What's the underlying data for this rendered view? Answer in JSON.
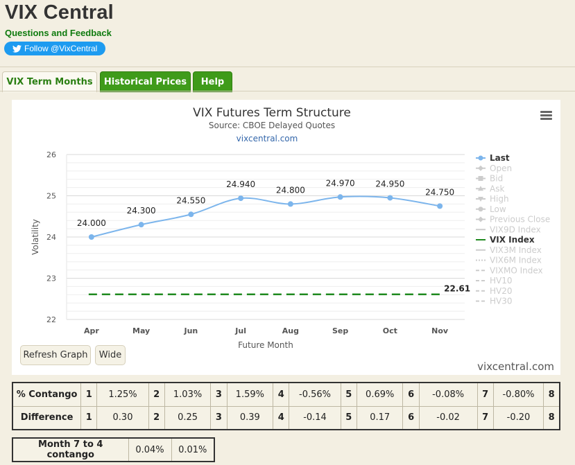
{
  "header": {
    "title": "VIX Central",
    "feedback_link": "Questions and Feedback",
    "follow_button": "Follow @VixCentral"
  },
  "tabs": [
    {
      "label": "VIX Term Months",
      "active": true
    },
    {
      "label": "Historical Prices",
      "active": false
    },
    {
      "label": "Help",
      "active": false
    }
  ],
  "chart": {
    "menu_icon": "hamburger-menu-icon",
    "buttons": {
      "refresh": "Refresh Graph",
      "wide": "Wide"
    },
    "watermark": "vixcentral.com",
    "accent_colors": {
      "last": "#7cb5ec",
      "vix": "#1f8a1f"
    }
  },
  "chart_data": {
    "type": "line",
    "title": "VIX Futures Term Structure",
    "subtitle": "Source: CBOE Delayed Quotes",
    "credit": "vixcentral.com",
    "xlabel": "Future Month",
    "ylabel": "Volatility",
    "categories": [
      "Apr",
      "May",
      "Jun",
      "Jul",
      "Aug",
      "Sep",
      "Oct",
      "Nov"
    ],
    "ylim": [
      22,
      26
    ],
    "yticks": [
      "22",
      "23",
      "24",
      "25",
      "26"
    ],
    "series": [
      {
        "name": "Last",
        "values": [
          24.0,
          24.3,
          24.55,
          24.94,
          24.8,
          24.97,
          24.95,
          24.75
        ],
        "labels": [
          "24.000",
          "24.300",
          "24.550",
          "24.940",
          "24.800",
          "24.970",
          "24.950",
          "24.750"
        ]
      },
      {
        "name": "VIX Index",
        "values": [
          22.61,
          22.61,
          22.61,
          22.61,
          22.61,
          22.61,
          22.61,
          22.61
        ],
        "end_label": "22.61"
      }
    ],
    "legend": {
      "placement": "right",
      "items": [
        {
          "label": "Last",
          "enabled": true,
          "symbol": "circle"
        },
        {
          "label": "Open",
          "enabled": false,
          "symbol": "diamond"
        },
        {
          "label": "Bid",
          "enabled": false,
          "symbol": "square"
        },
        {
          "label": "Ask",
          "enabled": false,
          "symbol": "triangle"
        },
        {
          "label": "High",
          "enabled": false,
          "symbol": "triangle-down"
        },
        {
          "label": "Low",
          "enabled": false,
          "symbol": "circle"
        },
        {
          "label": "Previous Close",
          "enabled": false,
          "symbol": "diamond"
        },
        {
          "label": "VIX9D Index",
          "enabled": false,
          "symbol": "line"
        },
        {
          "label": "VIX Index",
          "enabled": true,
          "symbol": "dash"
        },
        {
          "label": "VIX3M Index",
          "enabled": false,
          "symbol": "line"
        },
        {
          "label": "VIX6M Index",
          "enabled": false,
          "symbol": "dot"
        },
        {
          "label": "VIXMO Index",
          "enabled": false,
          "symbol": "dash"
        },
        {
          "label": "HV10",
          "enabled": false,
          "symbol": "dashdot"
        },
        {
          "label": "HV20",
          "enabled": false,
          "symbol": "dashdot"
        },
        {
          "label": "HV30",
          "enabled": false,
          "symbol": "dashdot"
        }
      ]
    },
    "grid": true
  },
  "contango_table": {
    "rows": [
      {
        "header": "% Contango",
        "cells": [
          [
            "1",
            "1.25%"
          ],
          [
            "2",
            "1.03%"
          ],
          [
            "3",
            "1.59%"
          ],
          [
            "4",
            "-0.56%"
          ],
          [
            "5",
            "0.69%"
          ],
          [
            "6",
            "-0.08%"
          ],
          [
            "7",
            "-0.80%"
          ],
          [
            "8",
            ""
          ]
        ]
      },
      {
        "header": "Difference",
        "cells": [
          [
            "1",
            "0.30"
          ],
          [
            "2",
            "0.25"
          ],
          [
            "3",
            "0.39"
          ],
          [
            "4",
            "-0.14"
          ],
          [
            "5",
            "0.17"
          ],
          [
            "6",
            "-0.02"
          ],
          [
            "7",
            "-0.20"
          ],
          [
            "8",
            ""
          ]
        ]
      }
    ]
  },
  "month74": {
    "label": "Month 7 to 4 contango",
    "values": [
      "0.04%",
      "0.01%"
    ]
  }
}
